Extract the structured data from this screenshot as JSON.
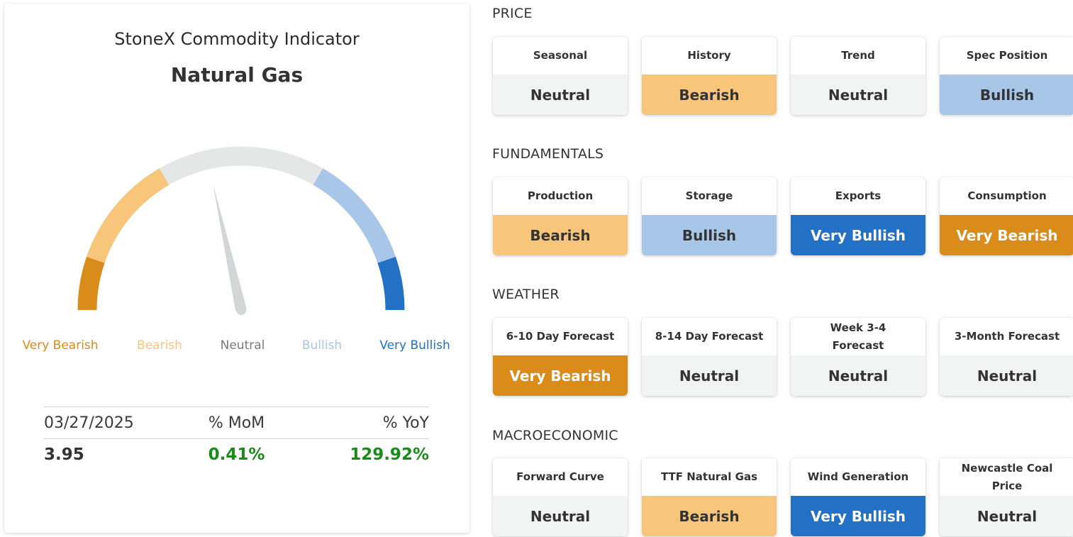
{
  "indicator": {
    "title": "StoneX Commodity Indicator",
    "commodity": "Natural Gas",
    "gauge_reading": "Neutral",
    "gauge_value_fraction": 0.43,
    "scale": [
      {
        "label": "Very Bearish",
        "color": "#da8c1a"
      },
      {
        "label": "Bearish",
        "color": "#f7c67a"
      },
      {
        "label": "Neutral",
        "color": "#7a7a7a"
      },
      {
        "label": "Bullish",
        "color": "#a8c6e8"
      },
      {
        "label": "Very Bullish",
        "color": "#2371c6"
      }
    ],
    "track_color": "#e5e7e7",
    "needle_color": "#d3d6d7"
  },
  "stats": {
    "date": "03/27/2025",
    "mom_header": "% MoM",
    "yoy_header": "% YoY",
    "price": "3.95",
    "mom": "0.41%",
    "yoy": "129.92%"
  },
  "sections": [
    {
      "title": "PRICE",
      "cards": [
        {
          "name": "Seasonal",
          "value": "Neutral",
          "status": "neutral"
        },
        {
          "name": "History",
          "value": "Bearish",
          "status": "bearish"
        },
        {
          "name": "Trend",
          "value": "Neutral",
          "status": "neutral"
        },
        {
          "name": "Spec Position",
          "value": "Bullish",
          "status": "bullish"
        }
      ]
    },
    {
      "title": "FUNDAMENTALS",
      "cards": [
        {
          "name": "Production",
          "value": "Bearish",
          "status": "bearish"
        },
        {
          "name": "Storage",
          "value": "Bullish",
          "status": "bullish"
        },
        {
          "name": "Exports",
          "value": "Very Bullish",
          "status": "very-bullish"
        },
        {
          "name": "Consumption",
          "value": "Very Bearish",
          "status": "very-bearish"
        }
      ]
    },
    {
      "title": "WEATHER",
      "cards": [
        {
          "name": "6-10 Day Forecast",
          "value": "Very Bearish",
          "status": "very-bearish"
        },
        {
          "name": "8-14 Day Forecast",
          "value": "Neutral",
          "status": "neutral"
        },
        {
          "name": "Week 3-4 Forecast",
          "value": "Neutral",
          "status": "neutral"
        },
        {
          "name": "3-Month Forecast",
          "value": "Neutral",
          "status": "neutral"
        }
      ]
    },
    {
      "title": "MACROECONOMIC",
      "cards": [
        {
          "name": "Forward Curve",
          "value": "Neutral",
          "status": "neutral"
        },
        {
          "name": "TTF Natural Gas",
          "value": "Bearish",
          "status": "bearish"
        },
        {
          "name": "Wind Generation",
          "value": "Very Bullish",
          "status": "very-bullish"
        },
        {
          "name": "Newcastle Coal Price",
          "value": "Neutral",
          "status": "neutral"
        }
      ]
    }
  ]
}
